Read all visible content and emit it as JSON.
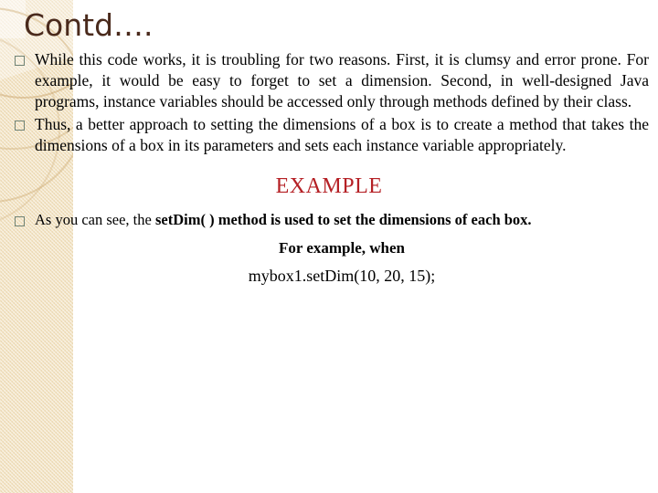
{
  "slide": {
    "title": "Contd….",
    "background_color": "#ffffff",
    "band_color": "#f2e2c0",
    "title_color": "#4a2a1c",
    "bullet_marker": "empty-square",
    "bullet_marker_color": "#6f8274"
  },
  "bullets": [
    {
      "marker": "□",
      "text": "While this code works, it is troubling for two reasons. First, it is clumsy and error prone. For example, it would be easy to forget to set a dimension. Second, in well-designed Java programs, instance variables should be accessed only through methods defined by their class."
    },
    {
      "marker": "□",
      "text": "Thus, a better approach to setting the dimensions of a box is to create a method that takes the dimensions of a box in its parameters and sets each instance variable appropriately."
    }
  ],
  "example": {
    "heading": "EXAMPLE",
    "heading_color": "#b52025",
    "bullet": {
      "marker": "□",
      "text_before": "As you can see, the ",
      "code_term": "setDim( )",
      "text_after": " method is used to set the dimensions of each box."
    },
    "lines": [
      "For example, when",
      "mybox1.setDim(10, 20, 15);"
    ]
  }
}
